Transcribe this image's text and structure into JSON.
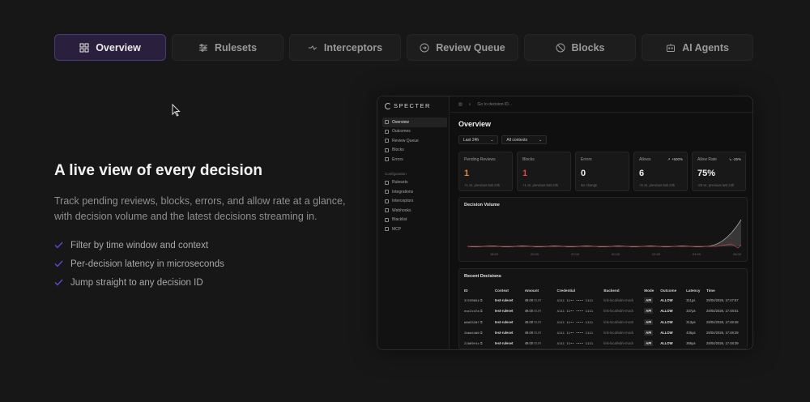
{
  "tabs": [
    {
      "label": "Overview",
      "icon": "grid-icon",
      "active": true
    },
    {
      "label": "Rulesets",
      "icon": "sliders-icon",
      "active": false
    },
    {
      "label": "Interceptors",
      "icon": "route-icon",
      "active": false
    },
    {
      "label": "Review Queue",
      "icon": "circle-arrow-icon",
      "active": false
    },
    {
      "label": "Blocks",
      "icon": "block-icon",
      "active": false
    },
    {
      "label": "AI Agents",
      "icon": "bot-icon",
      "active": false
    }
  ],
  "hero": {
    "title": "A live view of every decision",
    "description": "Track pending reviews, blocks, errors, and allow rate at a glance, with decision volume and the latest decisions streaming in.",
    "features": [
      "Filter by time window and context",
      "Per-decision latency in microseconds",
      "Jump straight to any decision ID"
    ]
  },
  "app": {
    "brand": "SPECTER",
    "search_placeholder": "Go to decision ID...",
    "nav": [
      {
        "label": "Overview",
        "active": true
      },
      {
        "label": "Outcomes"
      },
      {
        "label": "Review Queue"
      },
      {
        "label": "Blocks"
      },
      {
        "label": "Errors"
      }
    ],
    "config_label": "Configuration",
    "config_nav": [
      {
        "label": "Rulesets"
      },
      {
        "label": "Integrations"
      },
      {
        "label": "Interceptors"
      },
      {
        "label": "Webhooks"
      },
      {
        "label": "Blacklist"
      },
      {
        "label": "MCP"
      }
    ],
    "page_title": "Overview",
    "filters": {
      "time": "Last 24h",
      "context": "All contexts"
    },
    "cards": [
      {
        "label": "Pending Reviews",
        "value": "1",
        "trend": "",
        "sub": "+1 vs. previous last 24h",
        "tone": "warn"
      },
      {
        "label": "Blocks",
        "value": "1",
        "trend": "",
        "sub": "+1 vs. previous last 24h",
        "tone": "bad"
      },
      {
        "label": "Errors",
        "value": "0",
        "trend": "",
        "sub": "No change",
        "tone": "normal"
      },
      {
        "label": "Allows",
        "value": "6",
        "trend": "↗ +500%",
        "sub": "+5 vs. previous last 24h",
        "tone": "normal"
      },
      {
        "label": "Allow Rate",
        "value": "75%",
        "trend": "↘ -25%",
        "sub": "-25 vs. previous last 24h",
        "tone": "normal"
      }
    ],
    "volume_title": "Decision Volume",
    "volume_ticks": [
      "18:00",
      "20:00",
      "22:00",
      "00:00",
      "02:00",
      "04:00",
      "06:00"
    ],
    "recent_title": "Recent Decisions",
    "columns": [
      "ID",
      "Context",
      "Amount",
      "Credential",
      "Backend",
      "Mode",
      "Outcome",
      "Latency",
      "Time"
    ],
    "rows": [
      {
        "id": "37199054",
        "context": "test-ruleset",
        "amount": "49.00",
        "currency": "EUR",
        "credential": "4111 11•• •••• 1111",
        "backend": "link-local/vdm-mock",
        "mode": "API",
        "outcome": "ALLOW",
        "latency": "311µs",
        "time": "28/04/2026, 17:47:57"
      },
      {
        "id": "eac2c47a",
        "context": "test-ruleset",
        "amount": "49.00",
        "currency": "EUR",
        "credential": "4111 11•• •••• 1111",
        "backend": "link-local/vdm-mock",
        "mode": "API",
        "outcome": "ALLOW",
        "latency": "337µs",
        "time": "28/04/2026, 17:48:51"
      },
      {
        "id": "b6d33207",
        "context": "test-ruleset",
        "amount": "49.00",
        "currency": "EUR",
        "credential": "4111 11•• •••• 1111",
        "backend": "link-local/vdm-mock",
        "mode": "API",
        "outcome": "ALLOW",
        "latency": "313µs",
        "time": "28/04/2026, 17:48:48"
      },
      {
        "id": "2bbd44d6",
        "context": "test-ruleset",
        "amount": "49.00",
        "currency": "EUR",
        "credential": "4111 11•• •••• 1111",
        "backend": "link-local/vdm-mock",
        "mode": "API",
        "outcome": "ALLOW",
        "latency": "435µs",
        "time": "28/04/2026, 17:48:29"
      },
      {
        "id": "21069f4c",
        "context": "test-ruleset",
        "amount": "49.00",
        "currency": "EUR",
        "credential": "4111 11•• •••• 1111",
        "backend": "link-local/vdm-mock",
        "mode": "API",
        "outcome": "ALLOW",
        "latency": "366µs",
        "time": "28/04/2026, 17:48:39"
      }
    ]
  },
  "colors": {
    "accent": "#4c3a75",
    "warn": "#e28a3b",
    "bad": "#e0483e",
    "check": "#5b4bd6"
  }
}
